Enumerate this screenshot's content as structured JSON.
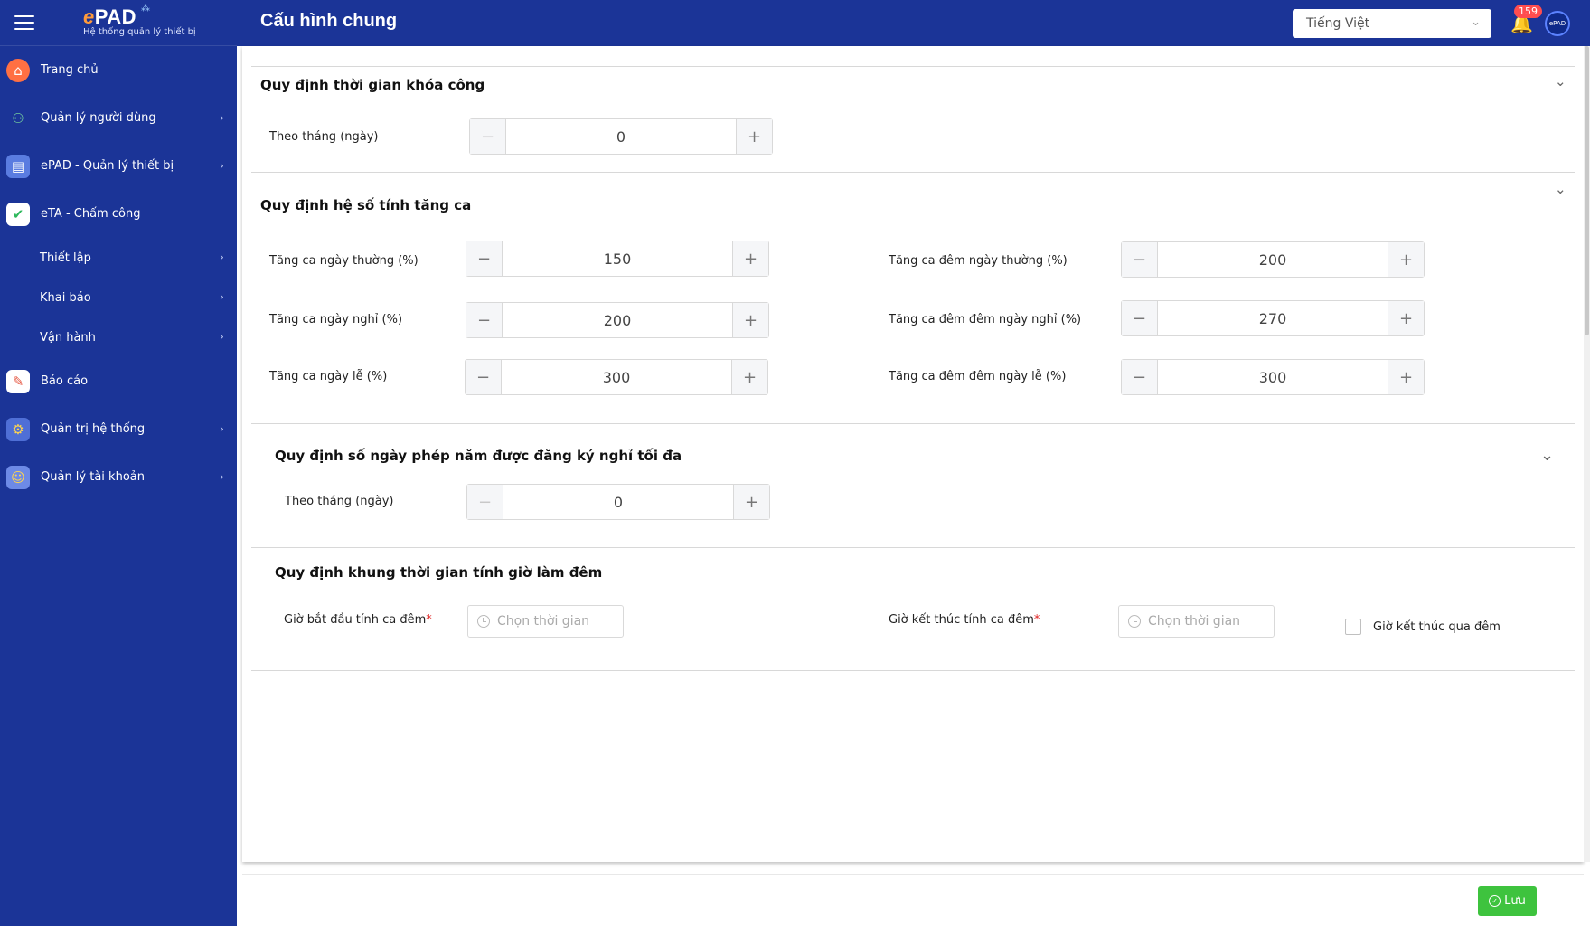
{
  "app": {
    "logo_text_prefix": "e",
    "logo_text_main": "PAD",
    "logo_subtitle": "Hệ thống quản lý thiết bị",
    "page_title": "Cấu hình chung",
    "language": "Tiếng Việt",
    "notification_count": "159",
    "avatar_text": "ePAD"
  },
  "sidebar": {
    "items": [
      {
        "label": "Trang chủ",
        "icon": "home-icon"
      },
      {
        "label": "Quản lý người dùng",
        "icon": "users-icon"
      },
      {
        "label": "ePAD - Quản lý thiết bị",
        "icon": "devices-icon"
      },
      {
        "label": "eTA - Chấm công",
        "icon": "calendar-icon"
      },
      {
        "label": "Thiết lập"
      },
      {
        "label": "Khai báo"
      },
      {
        "label": "Vận hành"
      },
      {
        "label": "Báo cáo",
        "icon": "report-icon"
      },
      {
        "label": "Quản trị hệ thống",
        "icon": "admin-icon"
      },
      {
        "label": "Quản lý tài khoản",
        "icon": "account-icon"
      }
    ]
  },
  "sections": {
    "lock": {
      "title": "Quy định thời gian khóa công",
      "month_label": "Theo tháng (ngày)",
      "month_value": "0"
    },
    "overtime": {
      "title": "Quy định hệ số tính tăng ca",
      "weekday_label": "Tăng ca ngày thường (%)",
      "weekday_value": "150",
      "dayoff_label": "Tăng ca ngày nghỉ (%)",
      "dayoff_value": "200",
      "holiday_label": "Tăng ca ngày lễ (%)",
      "holiday_value": "300",
      "night_weekday_label": "Tăng ca đêm ngày thường (%)",
      "night_weekday_value": "200",
      "night_dayoff_label": "Tăng ca đêm đêm ngày nghỉ (%)",
      "night_dayoff_value": "270",
      "night_holiday_label": "Tăng ca đêm đêm ngày lễ (%)",
      "night_holiday_value": "300"
    },
    "leave": {
      "title": "Quy định số ngày phép năm được đăng ký nghỉ tối đa",
      "month_label": "Theo tháng (ngày)",
      "month_value": "0"
    },
    "night": {
      "title": "Quy định khung thời gian tính giờ làm đêm",
      "start_label": "Giờ bắt đầu tính ca đêm",
      "end_label": "Giờ kết thúc tính ca đêm",
      "time_placeholder": "Chọn thời gian",
      "overnight_label": "Giờ kết thúc qua đêm",
      "required_mark": "*"
    }
  },
  "footer": {
    "save_label": "Lưu"
  },
  "colors": {
    "primary": "#1b3497",
    "save": "#3ec33e",
    "badge": "#ff4d4f"
  }
}
